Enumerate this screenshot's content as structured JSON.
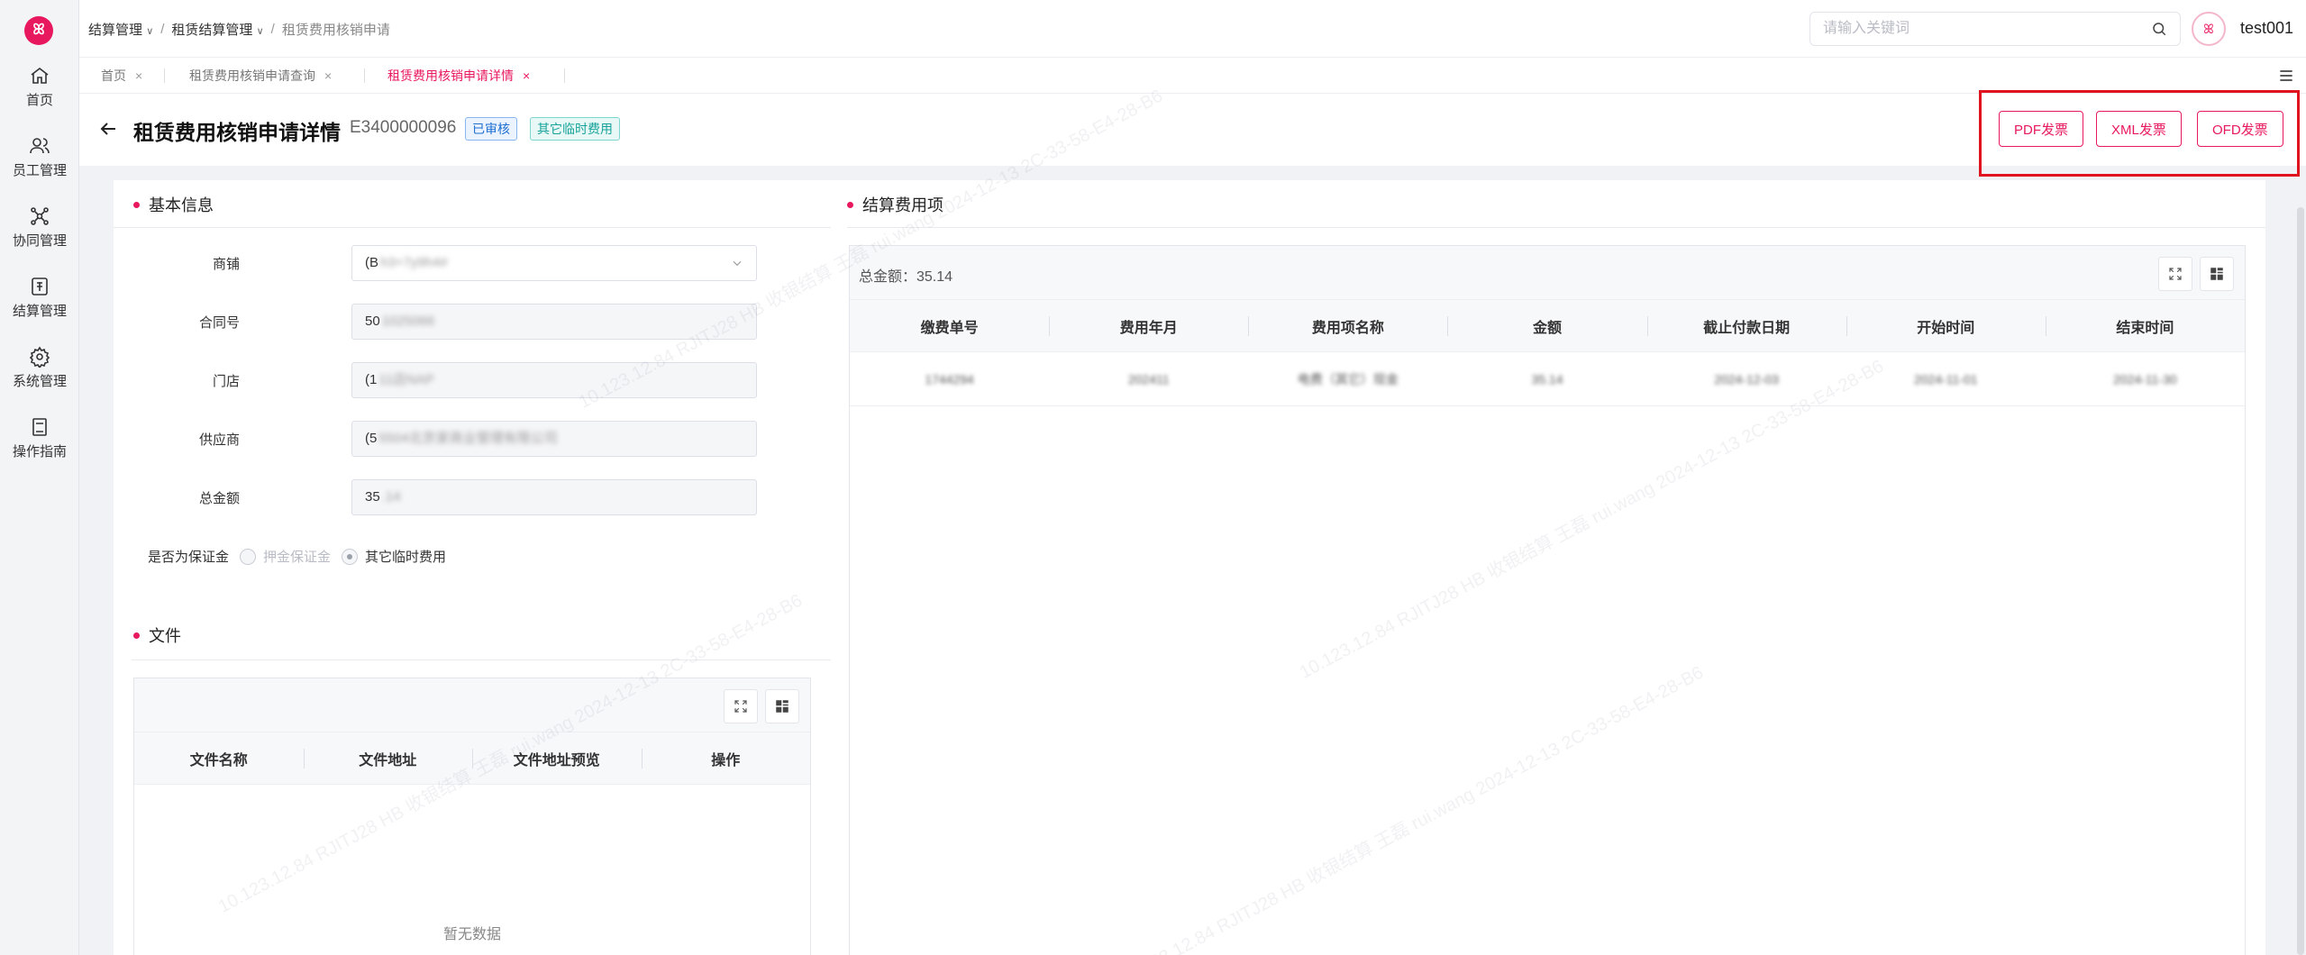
{
  "brand": {
    "logo_text": "ꕤ"
  },
  "sidebar": {
    "items": [
      {
        "label": "首页",
        "icon": "home-icon"
      },
      {
        "label": "员工管理",
        "icon": "users-icon"
      },
      {
        "label": "协同管理",
        "icon": "network-icon"
      },
      {
        "label": "结算管理",
        "icon": "settlement-icon"
      },
      {
        "label": "系统管理",
        "icon": "gear-icon"
      },
      {
        "label": "操作指南",
        "icon": "book-icon"
      }
    ]
  },
  "header": {
    "breadcrumb": [
      "结算管理",
      "租赁结算管理",
      "租赁费用核销申请"
    ],
    "search_placeholder": "请输入关键词",
    "username": "test001"
  },
  "tabs": [
    {
      "label": "首页",
      "active": false
    },
    {
      "label": "租赁费用核销申请查询",
      "active": false
    },
    {
      "label": "租赁费用核销申请详情",
      "active": true
    }
  ],
  "page": {
    "title": "租赁费用核销申请详情",
    "doc_no": "E3400000096",
    "status_tag": "已审核",
    "type_tag": "其它临时费用",
    "buttons": {
      "pdf": "PDF发票",
      "xml": "XML发票",
      "ofd": "OFD发票"
    }
  },
  "basic_info": {
    "title": "基本信息",
    "fields": [
      {
        "label": "商铺",
        "value": "(B",
        "blurred": "h3+7y9h4#"
      },
      {
        "label": "合同号",
        "value": "50",
        "blurred": "1025066"
      },
      {
        "label": "门店",
        "value": "(1",
        "blurred": "11店NAP"
      },
      {
        "label": "供应商",
        "value": "(5",
        "blurred": "5504北京家商业管理有限公司"
      },
      {
        "label": "总金额",
        "value": "35",
        "blurred": ".14"
      }
    ],
    "deposit_label": "是否为保证金",
    "radio_options": [
      {
        "label": "押金保证金",
        "checked": false,
        "disabled": true
      },
      {
        "label": "其它临时费用",
        "checked": true,
        "disabled": false
      }
    ]
  },
  "files": {
    "title": "文件",
    "columns": [
      "文件名称",
      "文件地址",
      "文件地址预览",
      "操作"
    ],
    "empty_text": "暂无数据"
  },
  "settlement": {
    "title": "结算费用项",
    "total_label": "总金额：35.14",
    "columns": [
      "缴费单号",
      "费用年月",
      "费用项名称",
      "金额",
      "截止付款日期",
      "开始时间",
      "结束时间"
    ],
    "rows": [
      [
        "1744294",
        "202411",
        "电费（其它）现金",
        "35.14",
        "2024-12-03",
        "2024-11-01",
        "2024-11-30"
      ]
    ]
  },
  "watermark_text": "10.123.12.84  RJITJ28 HB  收银结算 王磊  rui.wang  2024-12-13  2C-33-58-E4-28-B6",
  "colors": {
    "accent": "#e8185f",
    "highlight": "#e0141e"
  }
}
